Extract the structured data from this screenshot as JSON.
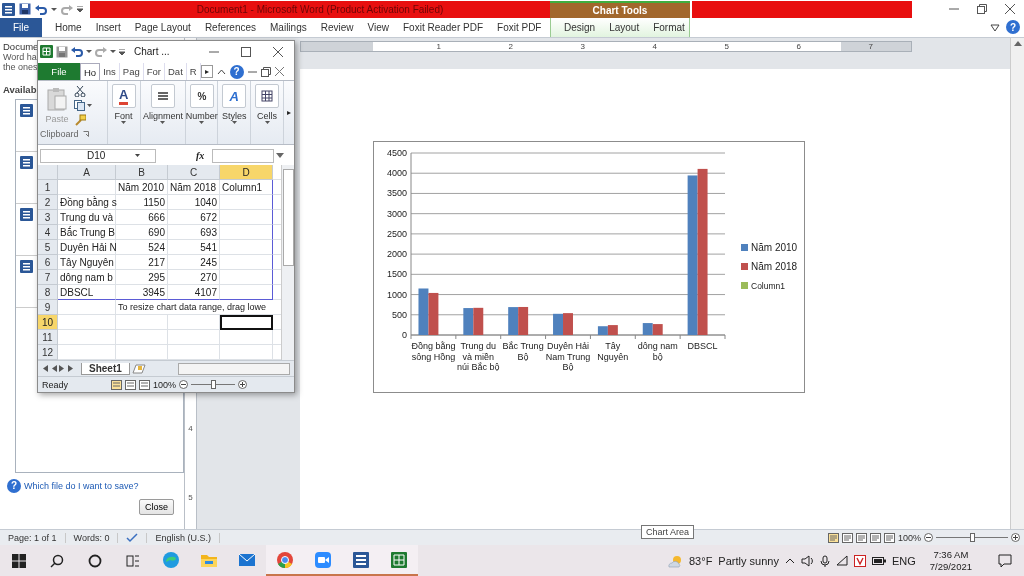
{
  "word": {
    "title": "Document1  -  Microsoft Word (Product Activation Failed)",
    "context_group": "Chart Tools",
    "help": "?",
    "tabs": [
      {
        "label": "File",
        "kind": "file"
      },
      {
        "label": "Home",
        "kind": "normal"
      },
      {
        "label": "Insert",
        "kind": "normal"
      },
      {
        "label": "Page Layout",
        "kind": "normal"
      },
      {
        "label": "References",
        "kind": "normal"
      },
      {
        "label": "Mailings",
        "kind": "normal"
      },
      {
        "label": "Review",
        "kind": "normal"
      },
      {
        "label": "View",
        "kind": "normal"
      },
      {
        "label": "Foxit Reader PDF",
        "kind": "normal"
      },
      {
        "label": "Foxit PDF",
        "kind": "normal"
      },
      {
        "label": "Design",
        "kind": "context"
      },
      {
        "label": "Layout",
        "kind": "context"
      },
      {
        "label": "Format",
        "kind": "context"
      }
    ],
    "ruler_numbers": [
      "1",
      "2",
      "3",
      "4",
      "5",
      "6",
      "7"
    ],
    "vertical_ruler_numbers": [
      "4",
      "5"
    ]
  },
  "recovery_pane": {
    "title": "Docume",
    "lines": [
      "Word ha",
      "the ones"
    ],
    "heading": "Availab",
    "files": [
      {
        "kind": "word-document"
      },
      {
        "kind": "word-document"
      },
      {
        "kind": "word-document"
      },
      {
        "kind": "word-document"
      }
    ],
    "help_link": "Which file do I want to save?",
    "close_button": "Close"
  },
  "chart": {
    "chart_data": {
      "type": "bar",
      "categories": [
        "Đồng bằng sông Hồng",
        "Trung du và miền núi Bắc bộ",
        "Bắc Trung Bộ",
        "Duyên Hải Nam Trung Bộ",
        "Tây Nguyên",
        "dông nam bộ",
        "DBSCL"
      ],
      "series": [
        {
          "name": "Năm 2010",
          "color": "#4f81bd",
          "values": [
            1150,
            666,
            690,
            524,
            217,
            295,
            3945
          ]
        },
        {
          "name": "Năm 2018",
          "color": "#c0504d",
          "values": [
            1040,
            672,
            693,
            541,
            245,
            270,
            4107
          ]
        },
        {
          "name": "Column1",
          "color": "#9bbb59",
          "values": [
            null,
            null,
            null,
            null,
            null,
            null,
            null
          ]
        }
      ],
      "ylim": [
        0,
        4500
      ],
      "yticks": [
        0,
        500,
        1000,
        1500,
        2000,
        2500,
        3000,
        3500,
        4000,
        4500
      ],
      "grid": true,
      "legend": true
    }
  },
  "tooltip": "Chart Area",
  "excel": {
    "title": "Chart ...",
    "help": "?",
    "tabs": [
      {
        "label": "File",
        "kind": "file",
        "selected": false
      },
      {
        "label": "Ho",
        "kind": "normal",
        "selected": true
      },
      {
        "label": "Ins",
        "kind": "normal",
        "selected": false
      },
      {
        "label": "Pag",
        "kind": "normal",
        "selected": false
      },
      {
        "label": "For",
        "kind": "normal",
        "selected": false
      },
      {
        "label": "Dat",
        "kind": "normal",
        "selected": false
      },
      {
        "label": "R",
        "kind": "normal",
        "selected": false
      }
    ],
    "tab_scroll": "▸",
    "groups": [
      {
        "kind": "clipboard",
        "label": "Clipboard",
        "button": "Paste"
      },
      {
        "kind": "font",
        "label": "Font",
        "glyph": "A"
      },
      {
        "kind": "alignment",
        "label": "Alignment"
      },
      {
        "kind": "number",
        "label": "Number",
        "glyph": "%"
      },
      {
        "kind": "styles",
        "label": "Styles",
        "glyph": "A"
      },
      {
        "kind": "cells",
        "label": "Cells"
      }
    ],
    "ribbon_scroll": "▸",
    "name_box": "D10",
    "fx": "fx",
    "columns": [
      {
        "label": "A",
        "selected": false
      },
      {
        "label": "B",
        "selected": false
      },
      {
        "label": "C",
        "selected": false
      },
      {
        "label": "D",
        "selected": true
      }
    ],
    "rows": [
      {
        "number": "1",
        "selected": false,
        "cells": [
          null,
          "Năm 2010",
          "Năm 2018",
          "Column1"
        ]
      },
      {
        "number": "2",
        "selected": false,
        "cells": [
          "Đồng bằng s",
          "1150",
          "1040",
          null
        ]
      },
      {
        "number": "3",
        "selected": false,
        "cells": [
          "Trung du và",
          "666",
          "672",
          null
        ]
      },
      {
        "number": "4",
        "selected": false,
        "cells": [
          "Bắc Trung B",
          "690",
          "693",
          null
        ]
      },
      {
        "number": "5",
        "selected": false,
        "cells": [
          "Duyên Hải N",
          "524",
          "541",
          null
        ]
      },
      {
        "number": "6",
        "selected": false,
        "cells": [
          "Tây Nguyên",
          "217",
          "245",
          null
        ]
      },
      {
        "number": "7",
        "selected": false,
        "cells": [
          "dông nam b",
          "295",
          "270",
          null
        ]
      },
      {
        "number": "8",
        "selected": false,
        "cells": [
          "DBSCL",
          "3945",
          "4107",
          null
        ]
      },
      {
        "number": "9",
        "selected": false,
        "note": "To resize chart data range, drag lowe"
      },
      {
        "number": "10",
        "selected": true,
        "cells": [
          null,
          null,
          null,
          null
        ]
      },
      {
        "number": "11",
        "selected": false,
        "cells": [
          null,
          null,
          null,
          null
        ]
      },
      {
        "number": "12",
        "selected": false,
        "cells": [
          null,
          null,
          null,
          null
        ]
      }
    ],
    "sheet_tab": "Sheet1",
    "status": "Ready",
    "zoom": "100%",
    "zoom_slider": {
      "level": 0.5
    }
  },
  "status_bar": {
    "page": "Page: 1 of 1",
    "words": "Words: 0",
    "language": "English (U.S.)",
    "zoom": "100%",
    "zoom_slider": {
      "level": 0.5
    }
  },
  "taskbar": {
    "apps": [
      {
        "kind": "edge",
        "running": false
      },
      {
        "kind": "explorer",
        "running": false
      },
      {
        "kind": "mail",
        "running": false
      },
      {
        "kind": "chrome",
        "running": true
      },
      {
        "kind": "zoom",
        "running": true
      },
      {
        "kind": "word",
        "running": true
      },
      {
        "kind": "excel",
        "running": true
      }
    ],
    "temperature": "83°F",
    "weather": "Partly sunny",
    "language": "ENG",
    "time": "7:36 AM",
    "date": "7/29/2021"
  }
}
